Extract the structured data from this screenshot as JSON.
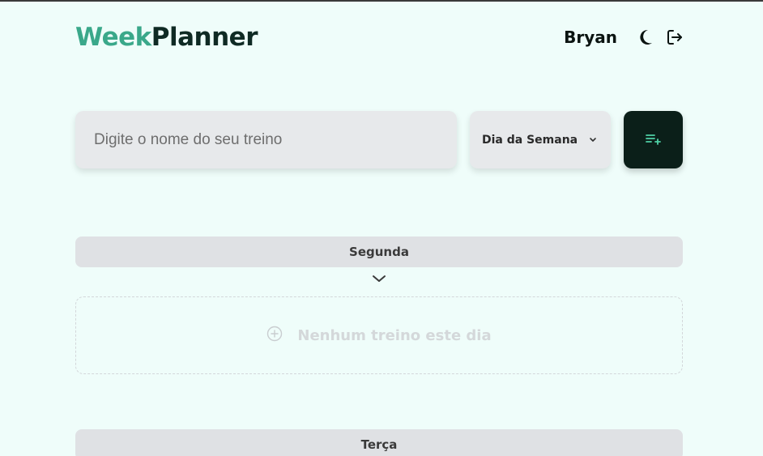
{
  "header": {
    "logo_part1": "Week",
    "logo_part2": "Planner",
    "user_name": "Bryan",
    "theme_icon": "moon-icon",
    "logout_icon": "logout-icon"
  },
  "form": {
    "name_placeholder": "Digite o nome do seu treino",
    "name_value": "",
    "day_select_label": "Dia da Semana",
    "add_icon": "playlist-add-icon"
  },
  "days": [
    {
      "label": "Segunda",
      "empty_text": "Nenhum treino este dia"
    },
    {
      "label": "Terça"
    }
  ],
  "colors": {
    "background": "#effdfa",
    "logo_accent": "#3aa88a",
    "logo_dark": "#0f2a24",
    "add_button": "#0b1f19",
    "add_icon": "#4fd1a5"
  }
}
